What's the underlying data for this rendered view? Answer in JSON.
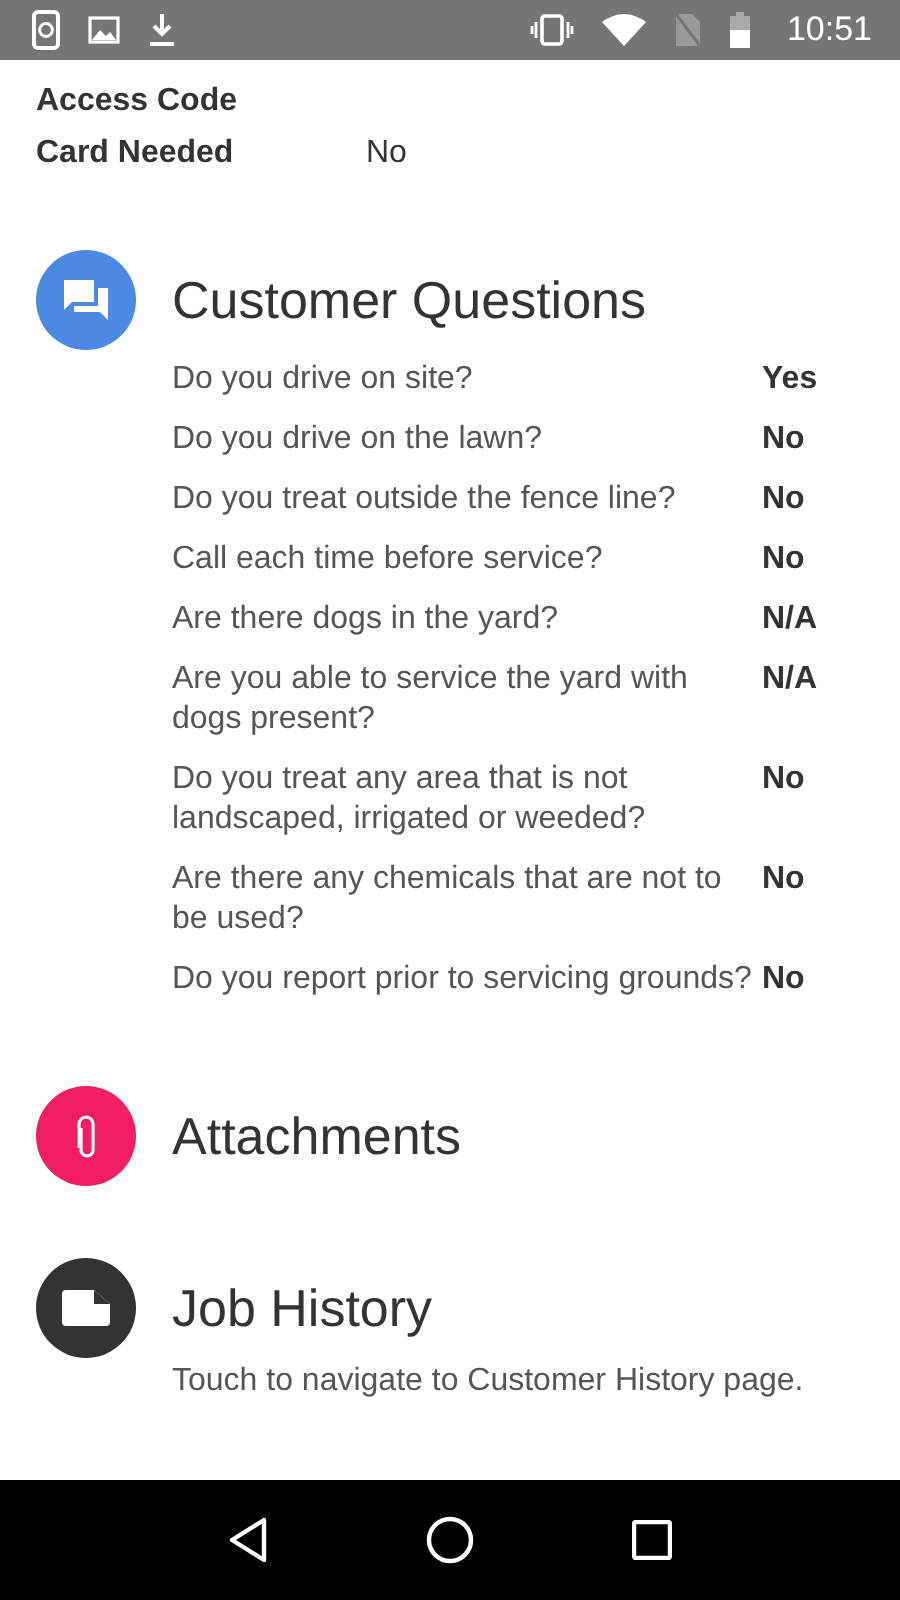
{
  "status_bar": {
    "time": "10:51"
  },
  "details": [
    {
      "label": "Access Code"
    },
    {
      "label": "Card Needed",
      "value": "No"
    }
  ],
  "sections": [
    {
      "title": "Customer Questions",
      "color": "#4a8ae4",
      "questions": [
        {
          "question": "Do you drive on site?",
          "answer": "Yes"
        },
        {
          "question": "Do you drive on the lawn?",
          "answer": "No"
        },
        {
          "question": "Do you treat outside the fence line?",
          "answer": "No"
        },
        {
          "question": "Call each time before service?",
          "answer": "No"
        },
        {
          "question": "Are there dogs in the yard?",
          "answer": "N/A"
        },
        {
          "question": "Are you able to service the yard with dogs present?",
          "answer": "N/A"
        },
        {
          "question": "Do you treat any area that is not landscaped, irrigated or weeded?",
          "answer": "No"
        },
        {
          "question": "Are there any chemicals that are not to be used?",
          "answer": "No"
        },
        {
          "question": "Do you report prior to servicing grounds?",
          "answer": "No"
        }
      ]
    },
    {
      "title": "Attachments",
      "color": "#f01d63"
    },
    {
      "title": "Job History",
      "color": "#333333",
      "subtitle": "Touch to navigate to Customer History page."
    }
  ]
}
